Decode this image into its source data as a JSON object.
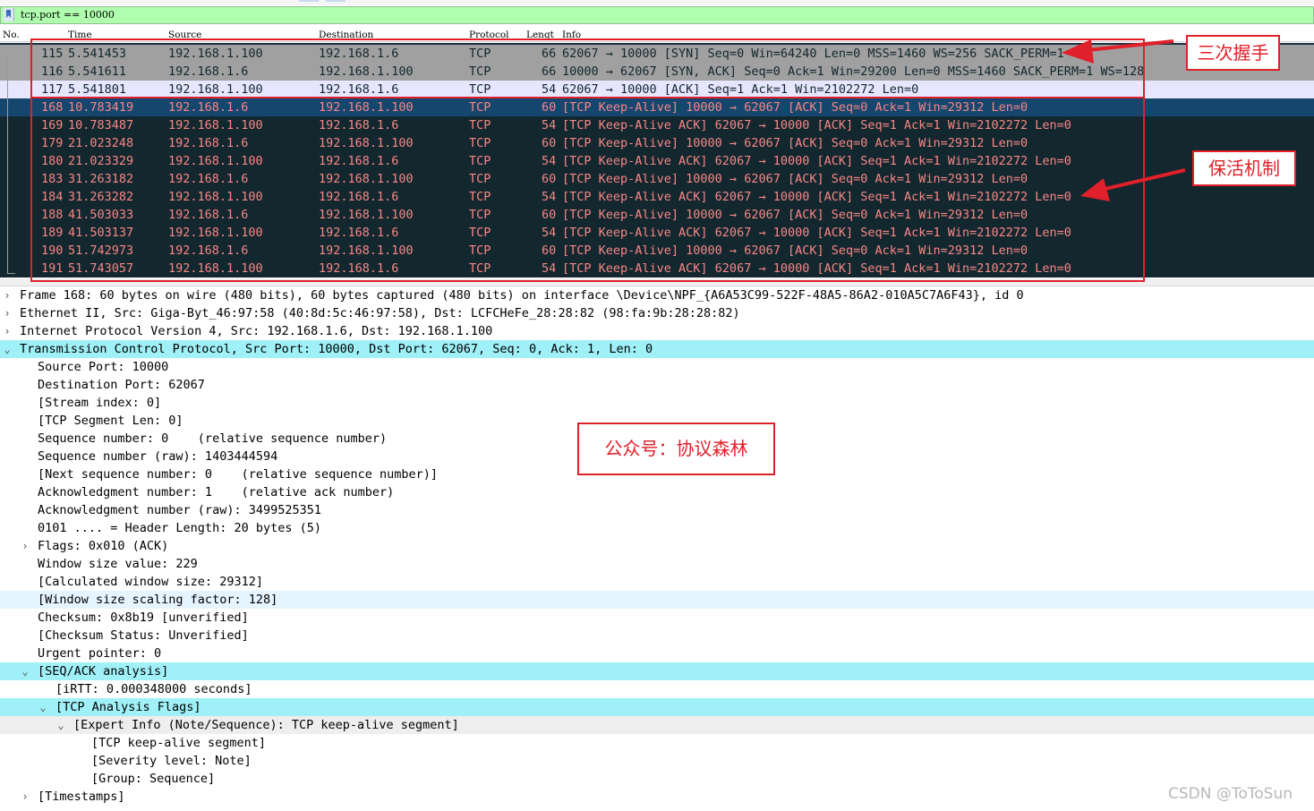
{
  "filter": {
    "text": "tcp.port == 10000"
  },
  "columns": {
    "no": "No.",
    "time": "Time",
    "source": "Source",
    "destination": "Destination",
    "protocol": "Protocol",
    "length": "Lengt",
    "info": "Info"
  },
  "packets": [
    {
      "no": "115",
      "time": "5.541453",
      "src": "192.168.1.100",
      "dst": "192.168.1.6",
      "proto": "TCP",
      "len": "66",
      "info": "62067 → 10000 [SYN] Seq=0 Win=64240 Len=0 MSS=1460 WS=256 SACK_PERM=1"
    },
    {
      "no": "116",
      "time": "5.541611",
      "src": "192.168.1.6",
      "dst": "192.168.1.100",
      "proto": "TCP",
      "len": "66",
      "info": "10000 → 62067 [SYN, ACK] Seq=0 Ack=1 Win=29200 Len=0 MSS=1460 SACK_PERM=1 WS=128"
    },
    {
      "no": "117",
      "time": "5.541801",
      "src": "192.168.1.100",
      "dst": "192.168.1.6",
      "proto": "TCP",
      "len": "54",
      "info": "62067 → 10000 [ACK] Seq=1 Ack=1 Win=2102272 Len=0"
    },
    {
      "no": "168",
      "time": "10.783419",
      "src": "192.168.1.6",
      "dst": "192.168.1.100",
      "proto": "TCP",
      "len": "60",
      "info": "[TCP Keep-Alive] 10000 → 62067 [ACK] Seq=0 Ack=1 Win=29312 Len=0"
    },
    {
      "no": "169",
      "time": "10.783487",
      "src": "192.168.1.100",
      "dst": "192.168.1.6",
      "proto": "TCP",
      "len": "54",
      "info": "[TCP Keep-Alive ACK] 62067 → 10000 [ACK] Seq=1 Ack=1 Win=2102272 Len=0"
    },
    {
      "no": "179",
      "time": "21.023248",
      "src": "192.168.1.6",
      "dst": "192.168.1.100",
      "proto": "TCP",
      "len": "60",
      "info": "[TCP Keep-Alive] 10000 → 62067 [ACK] Seq=0 Ack=1 Win=29312 Len=0"
    },
    {
      "no": "180",
      "time": "21.023329",
      "src": "192.168.1.100",
      "dst": "192.168.1.6",
      "proto": "TCP",
      "len": "54",
      "info": "[TCP Keep-Alive ACK] 62067 → 10000 [ACK] Seq=1 Ack=1 Win=2102272 Len=0"
    },
    {
      "no": "183",
      "time": "31.263182",
      "src": "192.168.1.6",
      "dst": "192.168.1.100",
      "proto": "TCP",
      "len": "60",
      "info": "[TCP Keep-Alive] 10000 → 62067 [ACK] Seq=0 Ack=1 Win=29312 Len=0"
    },
    {
      "no": "184",
      "time": "31.263282",
      "src": "192.168.1.100",
      "dst": "192.168.1.6",
      "proto": "TCP",
      "len": "54",
      "info": "[TCP Keep-Alive ACK] 62067 → 10000 [ACK] Seq=1 Ack=1 Win=2102272 Len=0"
    },
    {
      "no": "188",
      "time": "41.503033",
      "src": "192.168.1.6",
      "dst": "192.168.1.100",
      "proto": "TCP",
      "len": "60",
      "info": "[TCP Keep-Alive] 10000 → 62067 [ACK] Seq=0 Ack=1 Win=29312 Len=0"
    },
    {
      "no": "189",
      "time": "41.503137",
      "src": "192.168.1.100",
      "dst": "192.168.1.6",
      "proto": "TCP",
      "len": "54",
      "info": "[TCP Keep-Alive ACK] 62067 → 10000 [ACK] Seq=1 Ack=1 Win=2102272 Len=0"
    },
    {
      "no": "190",
      "time": "51.742973",
      "src": "192.168.1.6",
      "dst": "192.168.1.100",
      "proto": "TCP",
      "len": "60",
      "info": "[TCP Keep-Alive] 10000 → 62067 [ACK] Seq=0 Ack=1 Win=29312 Len=0"
    },
    {
      "no": "191",
      "time": "51.743057",
      "src": "192.168.1.100",
      "dst": "192.168.1.6",
      "proto": "TCP",
      "len": "54",
      "info": "[TCP Keep-Alive ACK] 62067 → 10000 [ACK] Seq=1 Ack=1 Win=2102272 Len=0"
    }
  ],
  "details": [
    "Frame 168: 60 bytes on wire (480 bits), 60 bytes captured (480 bits) on interface \\Device\\NPF_{A6A53C99-522F-48A5-86A2-010A5C7A6F43}, id 0",
    "Ethernet II, Src: Giga-Byt_46:97:58 (40:8d:5c:46:97:58), Dst: LCFCHeFe_28:28:82 (98:fa:9b:28:28:82)",
    "Internet Protocol Version 4, Src: 192.168.1.6, Dst: 192.168.1.100",
    "Transmission Control Protocol, Src Port: 10000, Dst Port: 62067, Seq: 0, Ack: 1, Len: 0",
    "Source Port: 10000",
    "Destination Port: 62067",
    "[Stream index: 0]",
    "[TCP Segment Len: 0]",
    "Sequence number: 0    (relative sequence number)",
    "Sequence number (raw): 1403444594",
    "[Next sequence number: 0    (relative sequence number)]",
    "Acknowledgment number: 1    (relative ack number)",
    "Acknowledgment number (raw): 3499525351",
    "0101 .... = Header Length: 20 bytes (5)",
    "Flags: 0x010 (ACK)",
    "Window size value: 229",
    "[Calculated window size: 29312]",
    "[Window size scaling factor: 128]",
    "Checksum: 0x8b19 [unverified]",
    "[Checksum Status: Unverified]",
    "Urgent pointer: 0",
    "[SEQ/ACK analysis]",
    "[iRTT: 0.000348000 seconds]",
    "[TCP Analysis Flags]",
    "[Expert Info (Note/Sequence): TCP keep-alive segment]",
    "[TCP keep-alive segment]",
    "[Severity level: Note]",
    "[Group: Sequence]",
    "[Timestamps]"
  ],
  "annotations": {
    "handshake": "三次握手",
    "keepalive": "保活机制",
    "account": "公众号：协议森林"
  },
  "watermark": "CSDN @ToToSun",
  "colors": {
    "filter_bg": "#afffaf",
    "keepalive_bg": "#12272e",
    "keepalive_fg": "#f78787",
    "selected_bg": "#15466e",
    "handshake_bg": "#a0a0a0",
    "detail_highlight": "#a0f0f8",
    "annotation_red": "#e0202a"
  }
}
